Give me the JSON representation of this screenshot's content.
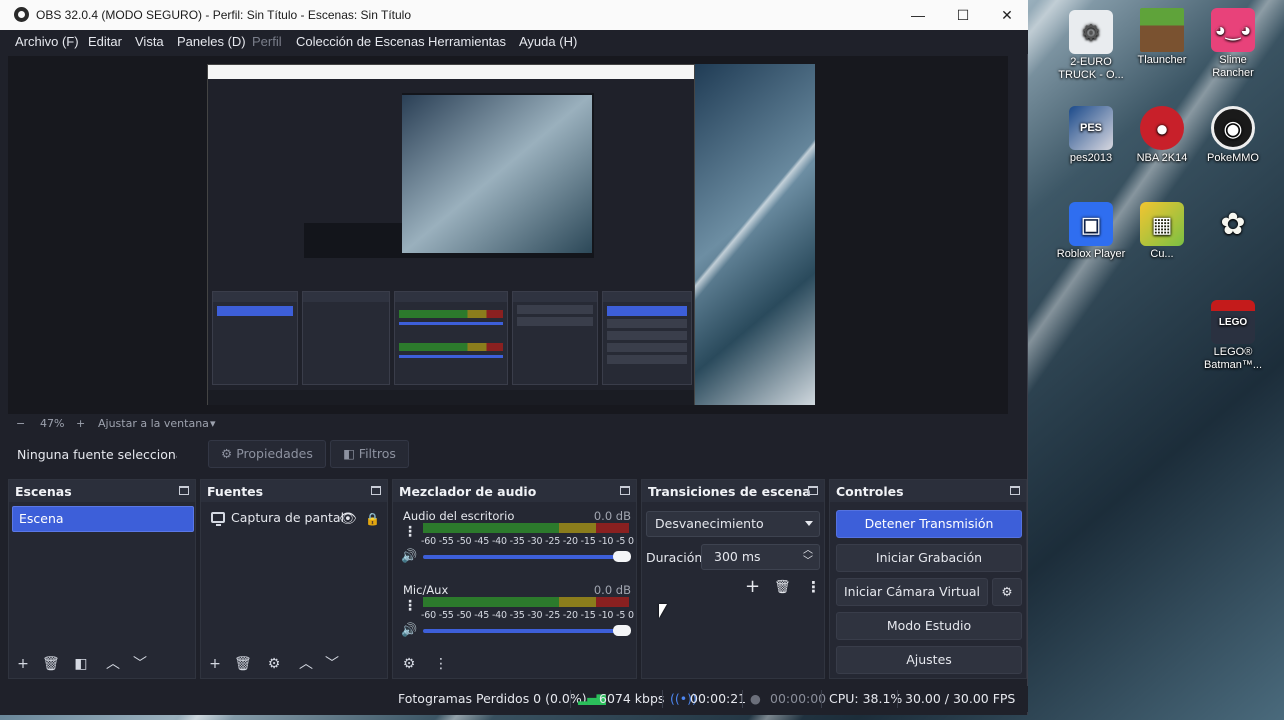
{
  "window": {
    "title": "OBS 32.0.4 (MODO SEGURO) - Perfil: Sin Título - Escenas: Sin Título",
    "minimize": "—",
    "maximize": "☐",
    "close": "✕"
  },
  "menu": {
    "items": [
      {
        "label": "Archivo (F)"
      },
      {
        "label": "Editar"
      },
      {
        "label": "Vista"
      },
      {
        "label": "Paneles (D)"
      },
      {
        "label": "Perfil"
      },
      {
        "label": "Colección de Escenas"
      },
      {
        "label": "Herramientas"
      },
      {
        "label": "Ayuda (H)"
      }
    ]
  },
  "zoom": {
    "minus": "−",
    "value": "47%",
    "plus": "+",
    "fit_label": "Ajustar a la ventana",
    "dropdown": "▾"
  },
  "source_toolbar": {
    "no_source": "Ninguna fuente seleccionad",
    "properties": "Propiedades",
    "filters": "Filtros"
  },
  "scenes": {
    "title": "Escenas",
    "items": [
      "Escena"
    ]
  },
  "sources": {
    "title": "Fuentes",
    "items": [
      "Captura de pantal"
    ]
  },
  "mixer": {
    "title": "Mezclador de audio",
    "channels": [
      {
        "name": "Audio del escritorio",
        "db": "0.0 dB",
        "volume": 1.0
      },
      {
        "name": "Mic/Aux",
        "db": "0.0 dB",
        "volume": 1.0
      }
    ],
    "ticks": "-60 -55 -50 -45 -40 -35 -30 -25 -20 -15 -10 -5  0"
  },
  "transitions": {
    "title": "Transiciones de escena",
    "selected": "Desvanecimiento",
    "duration_label": "Duración",
    "duration_value": "300 ms"
  },
  "controls": {
    "title": "Controles",
    "stop_stream": "Detener Transmisión",
    "start_recording": "Iniciar Grabación",
    "start_virtual_cam": "Iniciar Cámara Virtual",
    "studio_mode": "Modo Estudio",
    "settings": "Ajustes"
  },
  "status": {
    "dropped_frames": "Fotogramas Perdidos 0 (0.0%)",
    "bitrate": "6074 kbps",
    "stream_time": "00:00:21",
    "record_time": "00:00:00",
    "cpu": "CPU: 38.1%",
    "fps": "30.00 / 30.00 FPS"
  },
  "desktop_icons": [
    {
      "label": "2-EURO TRUCK - O...",
      "icon": "gear-icon"
    },
    {
      "label": "Tlauncher",
      "icon": "block-icon"
    },
    {
      "label": "Slime Rancher",
      "icon": "slime-icon"
    },
    {
      "label": "pes2013",
      "icon": "game-icon"
    },
    {
      "label": "NBA 2K14",
      "icon": "ball-icon"
    },
    {
      "label": "PokeMMO",
      "icon": "pokeball-icon"
    },
    {
      "label": "Roblox Player",
      "icon": "roblox-icon"
    },
    {
      "label": "Cu...",
      "icon": "cube-icon"
    },
    {
      "label": "",
      "icon": "flower-icon"
    },
    {
      "label": "LEGO® Batman™...",
      "icon": "lego-icon"
    }
  ],
  "colors": {
    "accent": "#3d5fd9",
    "panel": "#252833",
    "window_bg": "#1f212a"
  }
}
